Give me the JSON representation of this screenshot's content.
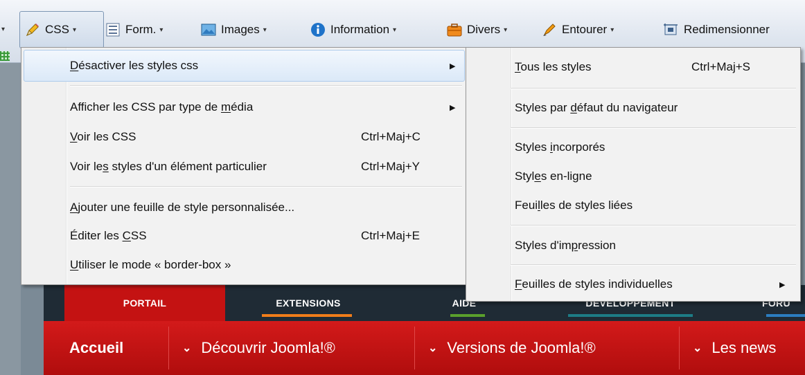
{
  "toolbar": {
    "items": [
      {
        "label": "CSS",
        "icon": "pencil-icon"
      },
      {
        "label": "Form.",
        "icon": "form-icon"
      },
      {
        "label": "Images",
        "icon": "image-icon"
      },
      {
        "label": "Information",
        "icon": "info-icon"
      },
      {
        "label": "Divers",
        "icon": "briefcase-icon"
      },
      {
        "label": "Entourer",
        "icon": "marker-icon"
      },
      {
        "label": "Redimensionner",
        "icon": "resize-icon"
      }
    ]
  },
  "css_menu": {
    "items": [
      {
        "pre": "",
        "u": "D",
        "post": "ésactiver les styles css",
        "shortcut": "",
        "submenu": true
      },
      {
        "pre": "Afficher les CSS par type de ",
        "u": "m",
        "post": "édia",
        "shortcut": "",
        "submenu": true
      },
      {
        "pre": "",
        "u": "V",
        "post": "oir les CSS",
        "shortcut": "Ctrl+Maj+C",
        "submenu": false
      },
      {
        "pre": "Voir le",
        "u": "s",
        "post": " styles d'un élément particulier",
        "shortcut": "Ctrl+Maj+Y",
        "submenu": false
      },
      {
        "pre": "",
        "u": "A",
        "post": "jouter une feuille de style personnalisée...",
        "shortcut": "",
        "submenu": false
      },
      {
        "pre": "Éditer les ",
        "u": "C",
        "post": "SS",
        "shortcut": "Ctrl+Maj+E",
        "submenu": false
      },
      {
        "pre": "",
        "u": "U",
        "post": "tiliser le mode « border-box »",
        "shortcut": "",
        "submenu": false
      }
    ]
  },
  "styles_submenu": {
    "items": [
      {
        "pre": "",
        "u": "T",
        "post": "ous les styles",
        "shortcut": "Ctrl+Maj+S",
        "submenu": false
      },
      {
        "pre": "Styles par ",
        "u": "d",
        "post": "éfaut du navigateur",
        "shortcut": "",
        "submenu": false
      },
      {
        "pre": "Styles ",
        "u": "i",
        "post": "ncorporés",
        "shortcut": "",
        "submenu": false
      },
      {
        "pre": "Styl",
        "u": "e",
        "post": "s en-ligne",
        "shortcut": "",
        "submenu": false
      },
      {
        "pre": "Feui",
        "u": "l",
        "post": "les de styles liées",
        "shortcut": "",
        "submenu": false
      },
      {
        "pre": "Styles d'im",
        "u": "p",
        "post": "ression",
        "shortcut": "",
        "submenu": false
      },
      {
        "pre": "",
        "u": "F",
        "post": "euilles de styles individuelles",
        "shortcut": "",
        "submenu": true
      }
    ]
  },
  "site_nav": {
    "tabs": [
      "PORTAIL",
      "EXTENSIONS",
      "AIDE",
      "DÉVELOPPEMENT",
      "FORU"
    ],
    "menu": [
      "Accueil",
      "Découvrir Joomla!®",
      "Versions de Joomla!®",
      "Les news"
    ]
  },
  "colors": {
    "accent_red": "#c41212",
    "highlight": "#dbe9f8",
    "tab_orange": "#f07d1a",
    "tab_green": "#5aa02c",
    "tab_teal": "#1d7c86",
    "tab_blue": "#2c7dc0"
  }
}
